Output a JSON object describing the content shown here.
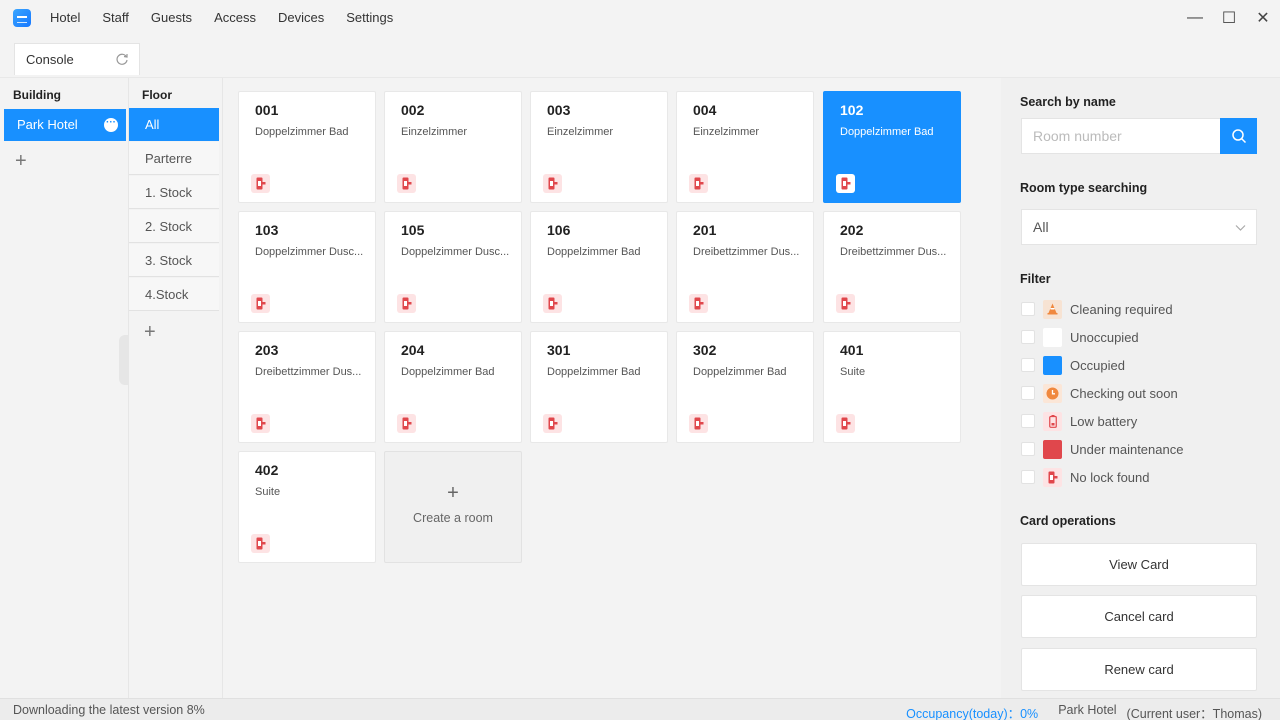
{
  "menu": [
    "Hotel",
    "Staff",
    "Guests",
    "Access",
    "Devices",
    "Settings"
  ],
  "window_controls": {
    "minimize": "—",
    "maximize": "☐",
    "close": "✕"
  },
  "tab": {
    "label": "Console"
  },
  "building": {
    "header": "Building",
    "items": [
      "Park Hotel"
    ],
    "add": "+"
  },
  "floor": {
    "header": "Floor",
    "items": [
      "All",
      "Parterre",
      "1. Stock",
      "2. Stock",
      "3. Stock",
      "4.Stock"
    ],
    "selected": "All",
    "add": "+"
  },
  "rooms": [
    {
      "number": "001",
      "type": "Doppelzimmer Bad"
    },
    {
      "number": "002",
      "type": "Einzelzimmer"
    },
    {
      "number": "003",
      "type": "Einzelzimmer"
    },
    {
      "number": "004",
      "type": "Einzelzimmer"
    },
    {
      "number": "102",
      "type": "Doppelzimmer Bad",
      "selected": true
    },
    {
      "number": "103",
      "type": "Doppelzimmer Dusc..."
    },
    {
      "number": "105",
      "type": "Doppelzimmer Dusc..."
    },
    {
      "number": "106",
      "type": "Doppelzimmer Bad"
    },
    {
      "number": "201",
      "type": "Dreibettzimmer Dus..."
    },
    {
      "number": "202",
      "type": "Dreibettzimmer Dus..."
    },
    {
      "number": "203",
      "type": "Dreibettzimmer Dus..."
    },
    {
      "number": "204",
      "type": "Doppelzimmer Bad"
    },
    {
      "number": "301",
      "type": "Doppelzimmer Bad"
    },
    {
      "number": "302",
      "type": "Doppelzimmer Bad"
    },
    {
      "number": "401",
      "type": "Suite"
    },
    {
      "number": "402",
      "type": "Suite"
    }
  ],
  "create_room": {
    "plus": "+",
    "label": "Create a room"
  },
  "search": {
    "title": "Search by name",
    "placeholder": "Room number"
  },
  "room_type": {
    "title": "Room type searching",
    "value": "All"
  },
  "filter": {
    "title": "Filter",
    "items": [
      {
        "label": "Cleaning required",
        "icon": "cleaning-cone-icon",
        "color": "#f7e3d3"
      },
      {
        "label": "Unoccupied",
        "icon": "unoccupied-swatch",
        "color": "#ffffff"
      },
      {
        "label": "Occupied",
        "icon": "occupied-swatch",
        "color": "#1890ff"
      },
      {
        "label": "Checking out soon",
        "icon": "clock-icon",
        "color": "#fbe6d7"
      },
      {
        "label": "Low battery",
        "icon": "battery-icon",
        "color": "#fde3e4"
      },
      {
        "label": "Under maintenance",
        "icon": "maintenance-swatch",
        "color": "#e0474c"
      },
      {
        "label": "No lock found",
        "icon": "lock-icon",
        "color": "#fde3e4"
      }
    ]
  },
  "card_ops": {
    "title": "Card operations",
    "buttons": [
      "View Card",
      "Cancel card",
      "Renew card"
    ]
  },
  "status": {
    "left": "Downloading the latest version 8%",
    "occupancy": "Occupancy(today)：0%",
    "building": "Park Hotel",
    "user": "(Current user：Thomas)"
  },
  "colors": {
    "accent": "#1890ff",
    "lock_red": "#e0474c"
  }
}
